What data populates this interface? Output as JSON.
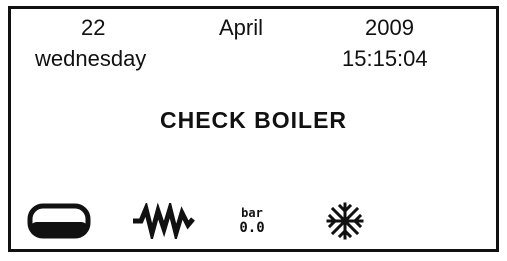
{
  "date": {
    "day": "22",
    "month": "April",
    "year": "2009",
    "weekday": "wednesday",
    "time": "15:15:04"
  },
  "message": "CHECK BOILER",
  "pressure": {
    "unit": "bar",
    "value": "0.0"
  },
  "icons": [
    "tank-icon",
    "waveform-icon",
    "pressure-gauge-icon",
    "snowflake-icon"
  ],
  "colors": {
    "ink": "#111111",
    "background": "#ffffff"
  }
}
